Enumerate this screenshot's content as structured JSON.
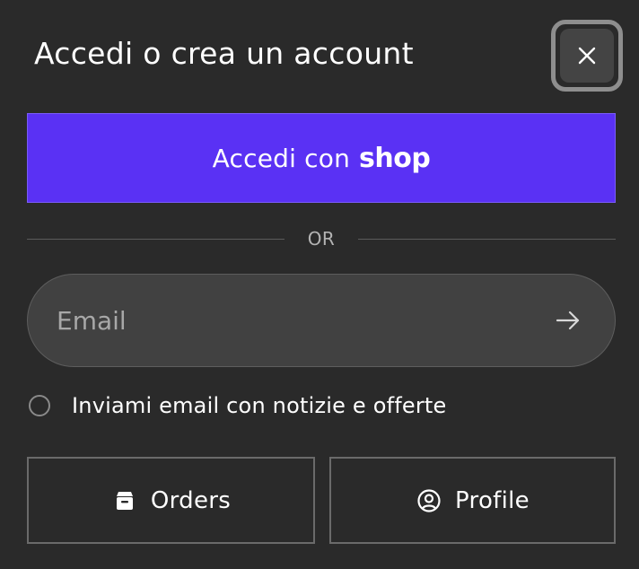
{
  "dialog": {
    "title": "Accedi o crea un account",
    "close_icon": "close-icon"
  },
  "shop_login": {
    "label": "Accedi con",
    "logo_text": "shop",
    "background_color": "#5a31f4"
  },
  "divider": {
    "text": "OR"
  },
  "email": {
    "value": "",
    "placeholder": "Email",
    "submit_icon": "arrow-right-icon"
  },
  "newsletter": {
    "label": "Inviami email con notizie e offerte",
    "checked": false
  },
  "nav": {
    "orders_label": "Orders",
    "orders_icon": "store-box-icon",
    "profile_label": "Profile",
    "profile_icon": "user-circle-icon"
  }
}
